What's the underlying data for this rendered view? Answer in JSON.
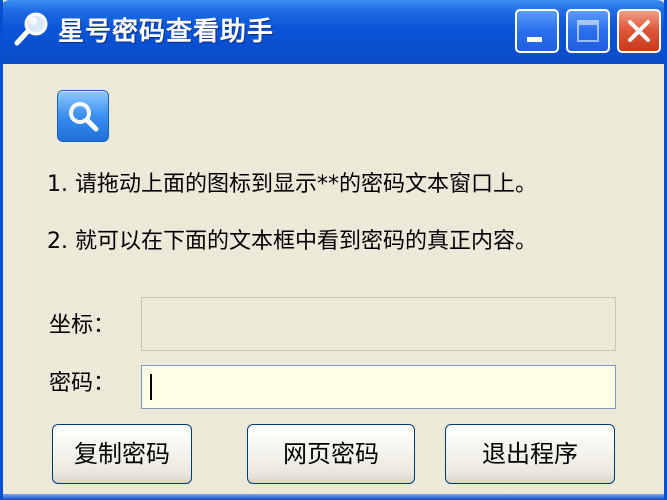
{
  "window": {
    "title": "星号密码查看助手",
    "controls": {
      "minimize": "minimize-icon",
      "maximize": "maximize-icon",
      "close": "close-icon"
    }
  },
  "main": {
    "search_icon": "magnifier-icon",
    "instructions": [
      "1. 请拖动上面的图标到显示**的密码文本窗口上。",
      "2. 就可以在下面的文本框中看到密码的真正内容。"
    ],
    "coordinate": {
      "label": "坐标：",
      "value": ""
    },
    "password": {
      "label": "密码：",
      "value": ""
    }
  },
  "buttons": {
    "copy": "复制密码",
    "web": "网页密码",
    "exit": "退出程序"
  },
  "colors": {
    "titlebar": "#0a4fd1",
    "close_button": "#e0583a",
    "window_bg": "#ece9d8",
    "password_field_bg": "#ffffe6"
  }
}
